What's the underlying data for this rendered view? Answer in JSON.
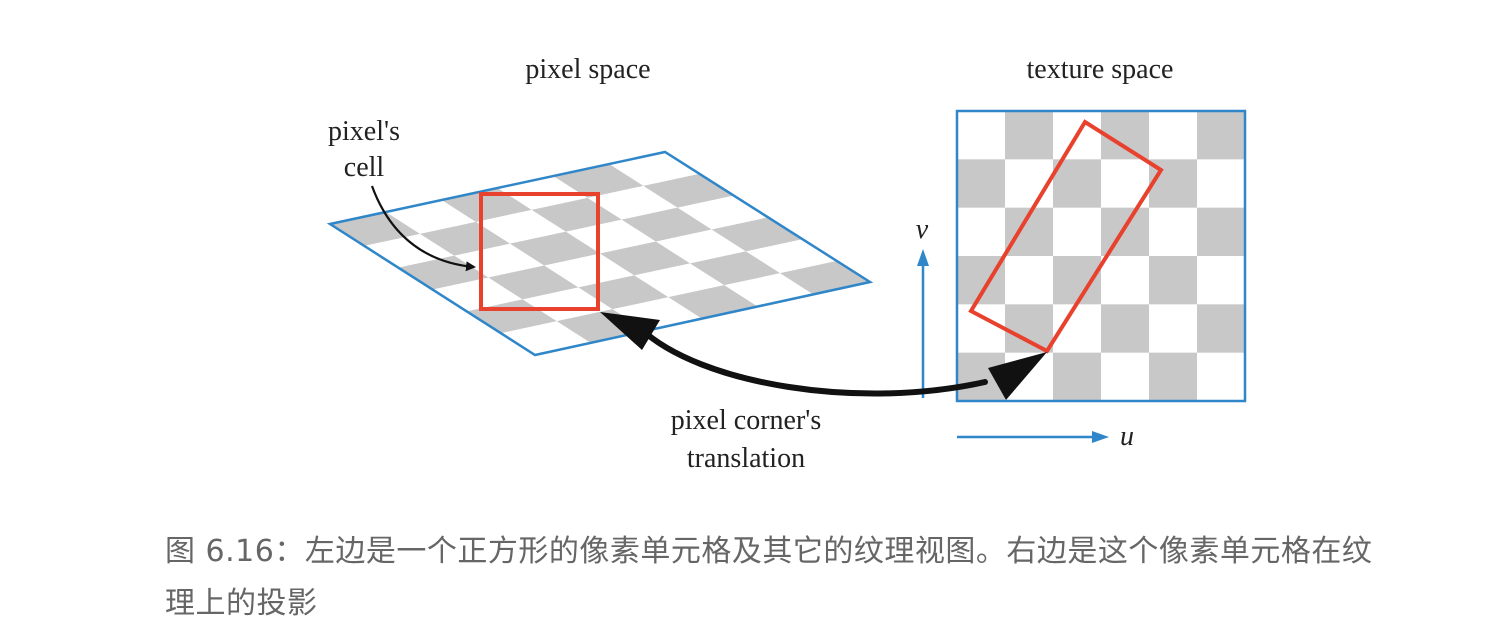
{
  "diagram": {
    "pixel_space_label": "pixel space",
    "texture_space_label": "texture space",
    "pixel_cell_label": [
      "pixel's",
      "cell"
    ],
    "corner_translation_label": [
      "pixel corner's",
      "translation"
    ],
    "axis_v_label": "v",
    "axis_u_label": "u",
    "colors": {
      "grid_border": "#2f86c8",
      "checker_gray": "#c8c8c8",
      "highlight": "#e8412d",
      "arrow": "#111111",
      "axis": "#2f86c8"
    }
  },
  "caption": {
    "text": "图 6.16：左边是一个正方形的像素单元格及其它的纹理视图。右边是这个像素单元格在纹理上的投影"
  }
}
